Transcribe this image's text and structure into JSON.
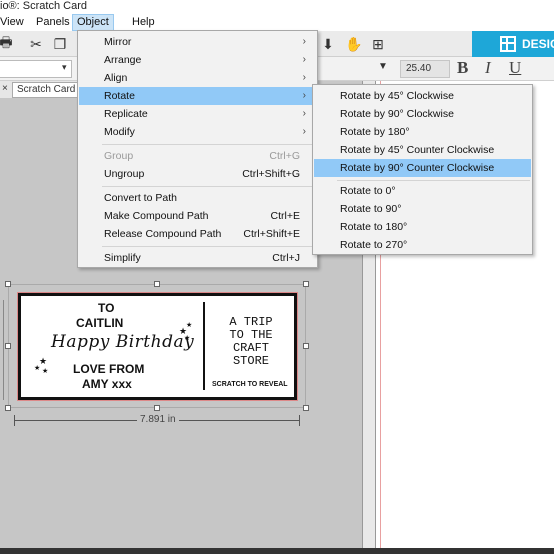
{
  "window": {
    "title": "io®: Scratch Card"
  },
  "menubar": {
    "items": [
      "View",
      "Panels",
      "Object",
      "Help"
    ]
  },
  "toolbar": {
    "design_label": "DESIGN",
    "font_size": "25.40",
    "bold": "B",
    "italic": "I",
    "underline": "U"
  },
  "document_tab": {
    "label": "Scratch Card",
    "close": "×"
  },
  "object_menu": {
    "items": [
      {
        "label": "Mirror",
        "shortcut": "",
        "submenu": true
      },
      {
        "label": "Arrange",
        "shortcut": "",
        "submenu": true
      },
      {
        "label": "Align",
        "shortcut": "",
        "submenu": true
      },
      {
        "label": "Rotate",
        "shortcut": "",
        "submenu": true,
        "highlighted": true
      },
      {
        "label": "Replicate",
        "shortcut": "",
        "submenu": true
      },
      {
        "label": "Modify",
        "shortcut": "",
        "submenu": true
      },
      {
        "label": "Group",
        "shortcut": "Ctrl+G",
        "disabled": true
      },
      {
        "label": "Ungroup",
        "shortcut": "Ctrl+Shift+G"
      },
      {
        "label": "Convert to Path",
        "shortcut": ""
      },
      {
        "label": "Make Compound Path",
        "shortcut": "Ctrl+E"
      },
      {
        "label": "Release Compound Path",
        "shortcut": "Ctrl+Shift+E"
      },
      {
        "label": "Simplify",
        "shortcut": "Ctrl+J"
      }
    ]
  },
  "rotate_submenu": {
    "items": [
      "Rotate by 45° Clockwise",
      "Rotate by 90° Clockwise",
      "Rotate by 180°",
      "Rotate by 45° Counter Clockwise",
      "Rotate by 90° Counter Clockwise",
      "Rotate to 0°",
      "Rotate to 90°",
      "Rotate to 180°",
      "Rotate to 270°"
    ],
    "highlighted": "Rotate by 90° Counter Clockwise"
  },
  "card": {
    "to": "TO",
    "name": "CAITLIN",
    "greeting": "Happy Birthday",
    "love_from": "LOVE FROM",
    "signature": "AMY xxx",
    "gift_line1": "A TRIP",
    "gift_line2": "TO THE",
    "gift_line3": "CRAFT",
    "gift_line4": "STORE",
    "scratch_note": "SCRATCH TO REVEAL"
  },
  "dimension": {
    "width_label": "7.891 in"
  },
  "colors": {
    "accent": "#1ea7d8",
    "menu_highlight": "#91c9f7",
    "menubar_active": "#cce4f7"
  }
}
